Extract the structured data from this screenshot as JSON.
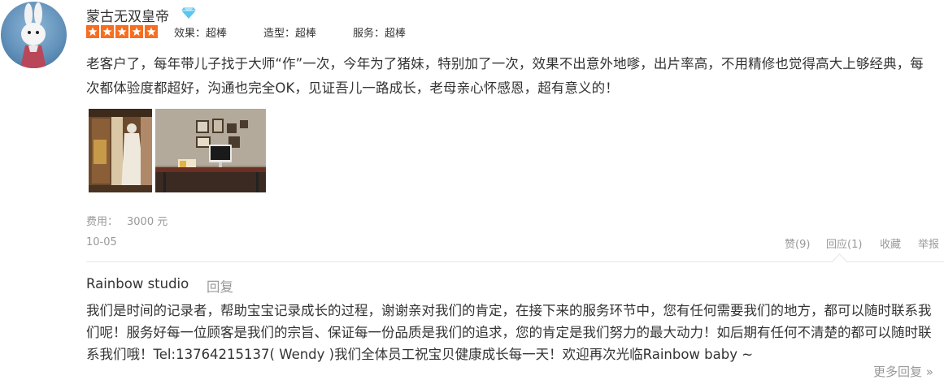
{
  "review": {
    "username": "蒙古无双皇帝",
    "badge_icon": "diamond-icon",
    "rating": {
      "stars": 5,
      "max_stars": 5,
      "star_color": "#f86e21",
      "effect": "效果：超棒",
      "styling": "造型：超棒",
      "service": "服务：超棒"
    },
    "text": "老客户了，每年带儿子找于大师“作”一次，今年为了猪妹，特别加了一次，效果不出意外地嗲，出片率高，不用精修也觉得高大上够经典，每次都体验度都超好，沟通也完全OK，见证吾儿一路成长，老母亲心怀感恩，超有意义的！",
    "photos": [
      "photo-thumbnail-closet",
      "photo-thumbnail-studio-desk"
    ],
    "cost_label": "费用：",
    "cost_value": "3000 元",
    "date": "10-05",
    "actions": {
      "like": "赞(9)",
      "reply": "回应(1)",
      "favorite": "收藏",
      "report": "举报"
    }
  },
  "merchant_reply": {
    "author": "Rainbow studio",
    "label": "回复",
    "text": "我们是时间的记录者，帮助宝宝记录成长的过程，谢谢亲对我们的肯定，在接下来的服务环节中，您有任何需要我们的地方，都可以随时联系我们呢！服务好每一位顾客是我们的宗旨、保证每一份品质是我们的追求，您的肯定是我们努力的最大动力！如后期有任何不清楚的都可以随时联系我们哦！Tel:13764215137( Wendy )我们全体员工祝宝贝健康成长每一天！欢迎再次光临Rainbow baby ~"
  },
  "more_replies": "更多回复 »"
}
